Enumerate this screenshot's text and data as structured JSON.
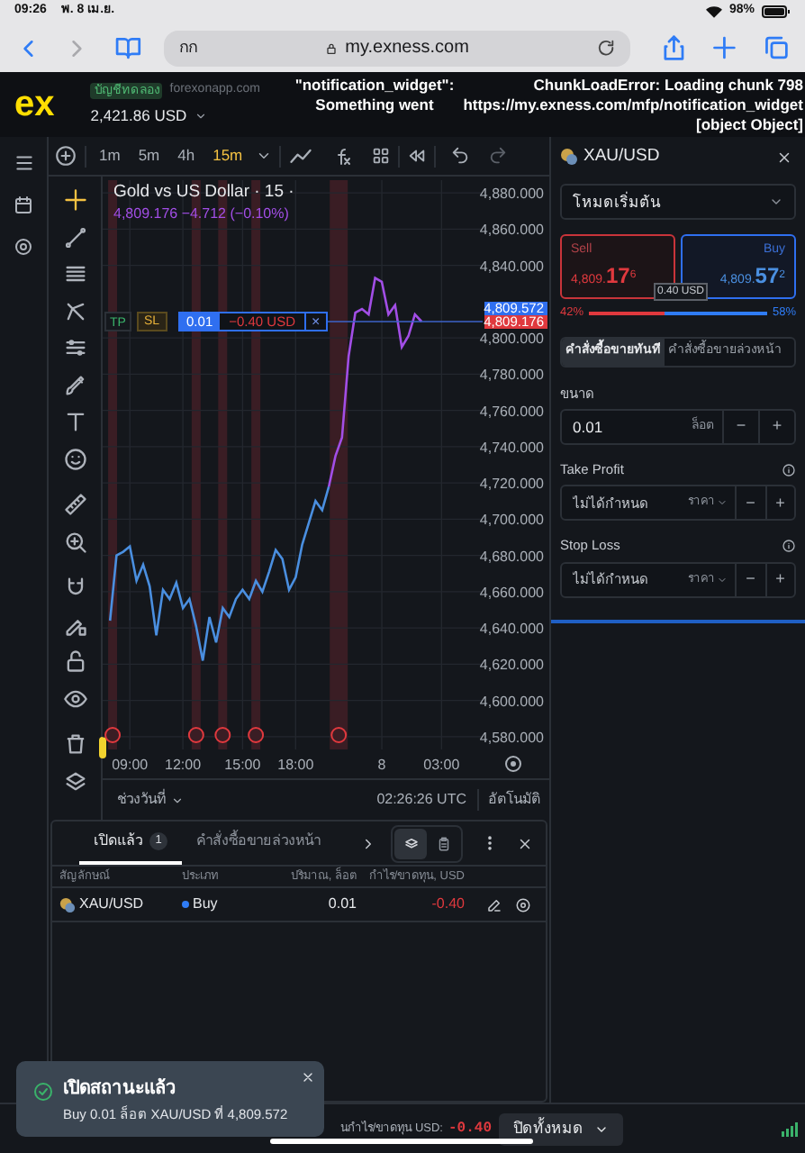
{
  "status_bar": {
    "time": "09:26",
    "date": "พ. 8 เม.ย.",
    "battery": "98%"
  },
  "browser": {
    "text_size": "กก",
    "url": "my.exness.com"
  },
  "header": {
    "logo": "ex",
    "account_badge": "บัญชีทดลอง",
    "domain": "forexonapp.com",
    "balance": "2,421.86 USD",
    "error_middle": [
      "\"notification_widget\":",
      "Something went"
    ],
    "error_right": [
      "ChunkLoadError: Loading chunk 798",
      "https://my.exness.com/mfp/notification_widget",
      "[object Object]"
    ]
  },
  "chart_toolbar": {
    "timeframes": [
      {
        "label": "1m",
        "selected": false
      },
      {
        "label": "5m",
        "selected": false
      },
      {
        "label": "4h",
        "selected": false
      },
      {
        "label": "15m",
        "selected": true
      }
    ]
  },
  "chart": {
    "title": "Gold vs US Dollar · 15 ·",
    "quote": "4,809.176 −4.712 (−0.10%)",
    "position": {
      "tp": "TP",
      "sl": "SL",
      "volume": "0.01",
      "pnl": "−0.40 USD",
      "close": "×"
    },
    "ask_label": "4,809.572",
    "bid_label": "4,809.176",
    "chart_data": {
      "type": "line",
      "categories": [
        null,
        null,
        null,
        "09:00",
        null,
        null,
        null,
        null,
        null,
        null,
        null,
        "12:00",
        null,
        null,
        null,
        null,
        null,
        null,
        null,
        null,
        "15:00",
        null,
        null,
        null,
        null,
        null,
        null,
        null,
        "18:00",
        null,
        null,
        null,
        null,
        null,
        null,
        null,
        null,
        null,
        null,
        null,
        null,
        "8",
        null,
        null,
        null,
        null,
        null,
        null,
        null,
        null,
        "03:00"
      ],
      "series": [
        {
          "color": "#4a8fe0",
          "values": [
            4644,
            4680,
            4682,
            4685,
            4666,
            4675,
            4663,
            4636,
            4661,
            4656,
            4665,
            4651,
            4656,
            4641,
            4622,
            4646,
            4632,
            4651,
            4646,
            4656,
            4661,
            4656,
            4666,
            4660,
            4671,
            4683,
            4678,
            4661,
            4668,
            4686,
            4698,
            4710,
            4705,
            4718,
            null,
            null,
            null,
            null,
            null,
            null,
            null,
            null,
            null,
            null,
            null,
            null,
            null,
            null,
            null,
            null,
            null
          ]
        },
        {
          "color": "#a24ee6",
          "values": [
            null,
            null,
            null,
            null,
            null,
            null,
            null,
            null,
            null,
            null,
            null,
            null,
            null,
            null,
            null,
            null,
            null,
            null,
            null,
            null,
            null,
            null,
            null,
            null,
            null,
            null,
            null,
            null,
            null,
            null,
            null,
            null,
            null,
            4718,
            4735,
            4745,
            4790,
            4814,
            4816,
            4813,
            4833,
            4831,
            4813,
            4818,
            4795,
            4801,
            4813,
            4809,
            null,
            null,
            null
          ]
        }
      ],
      "grid": true,
      "ylim": [
        4573,
        4887
      ],
      "yticks": [
        {
          "value": 4580,
          "label": "4,580.000"
        },
        {
          "value": 4600,
          "label": "4,600.000"
        },
        {
          "value": 4620,
          "label": "4,620.000"
        },
        {
          "value": 4640,
          "label": "4,640.000"
        },
        {
          "value": 4660,
          "label": "4,660.000"
        },
        {
          "value": 4680,
          "label": "4,680.000"
        },
        {
          "value": 4700,
          "label": "4,700.000"
        },
        {
          "value": 4720,
          "label": "4,720.000"
        },
        {
          "value": 4740,
          "label": "4,740.000"
        },
        {
          "value": 4760,
          "label": "4,760.000"
        },
        {
          "value": 4780,
          "label": "4,780.000"
        },
        {
          "value": 4800,
          "label": "4,800.000"
        },
        {
          "value": 4840,
          "label": "4,840.000"
        },
        {
          "value": 4860,
          "label": "4,860.000"
        },
        {
          "value": 4880,
          "label": "4,880.000"
        }
      ]
    },
    "range_label": "ช่วงวันที่",
    "clock": "02:26:26 UTC",
    "auto": "อัตโนมัติ"
  },
  "order_panel": {
    "symbol": "XAU/USD",
    "mode": "โหมดเริ่มต้น",
    "quotes": [
      {
        "kind": "sell",
        "label": "Sell",
        "price_main": "4,809.",
        "price_big": "17",
        "price_sup": "6"
      },
      {
        "kind": "buy",
        "label": "Buy",
        "price_main": "4,809.",
        "price_big": "57",
        "price_sup": "2"
      }
    ],
    "spread": "0.40 USD",
    "sentiment": {
      "sell_pct": "42%",
      "buy_pct": "58%",
      "level": 0.42
    },
    "tabs": [
      {
        "label": "คำสั่งซื้อขายทันที",
        "selected": true
      },
      {
        "label": "คำสั่งซื้อขายล่วงหน้า",
        "selected": false
      }
    ],
    "volume": {
      "label": "ขนาด",
      "value": "0.01",
      "unit": "ล็อต",
      "minus": "−",
      "plus": "+"
    },
    "take_profit": {
      "label": "Take Profit",
      "placeholder": "ไม่ได้กำหนด",
      "unit": "ราคา",
      "minus": "−",
      "plus": "+"
    },
    "stop_loss": {
      "label": "Stop Loss",
      "placeholder": "ไม่ได้กำหนด",
      "unit": "ราคา",
      "minus": "−",
      "plus": "+"
    }
  },
  "positions_panel": {
    "tabs": [
      {
        "label": "เปิดแล้ว",
        "count": "1",
        "selected": true
      },
      {
        "label": "คำสั่งซื้อขายล่วงหน้า",
        "selected": false
      }
    ],
    "view_toggle": [
      {
        "selected": true
      },
      {
        "selected": false
      }
    ],
    "columns": [
      "สัญลักษณ์",
      "ประเภท",
      "ปริมาณ, ล็อต",
      "กำไร/ขาดทุน, USD"
    ],
    "rows": [
      {
        "symbol": "XAU/USD",
        "type": "Buy",
        "volume": "0.01",
        "pnl": "-0.40"
      }
    ]
  },
  "footer": {
    "pnl_label": "นกำไร/ขาดทุน USD:",
    "pnl": "-0.40",
    "close_all": "ปิดทั้งหมด"
  },
  "toast": {
    "title": "เปิดสถานะแล้ว",
    "message": "Buy 0.01 ล็อต XAU/USD ที่ 4,809.572"
  }
}
